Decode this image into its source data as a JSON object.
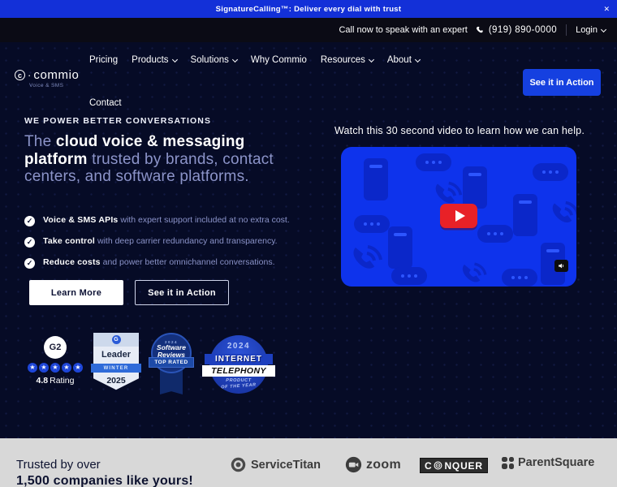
{
  "icons": {
    "close": "✕",
    "check": "✓",
    "star": "★"
  },
  "banner": {
    "text": "SignatureCalling™: Deliver every dial with trust"
  },
  "topbar": {
    "call_text": "Call now to speak with an expert",
    "phone": "(919) 890-0000",
    "login_label": "Login"
  },
  "nav": {
    "logo_icon": "c",
    "logo_dot": "·",
    "logo_text": "commio",
    "logo_sub": "Voice & SMS",
    "items": [
      {
        "label": "Pricing"
      },
      {
        "label": "Products"
      },
      {
        "label": "Solutions"
      },
      {
        "label": "Why Commio"
      },
      {
        "label": "Resources"
      },
      {
        "label": "About"
      },
      {
        "label": "Contact"
      }
    ],
    "cta_label": "See it in Action"
  },
  "hero": {
    "eyebrow": "WE POWER BETTER CONVERSATIONS",
    "heading_prefix": "The ",
    "heading_bold": "cloud voice & messaging platform",
    "heading_rest": " trusted by brands, contact centers, and software platforms.",
    "bullets": [
      {
        "bold": "Voice & SMS APIs",
        "rest": " with expert support included at no extra cost."
      },
      {
        "bold": "Take control",
        "rest": " with deep carrier redundancy and transparency."
      },
      {
        "bold": "Reduce costs",
        "rest": " and power better omnichannel conversations."
      }
    ],
    "learn_more_label": "Learn More",
    "see_action_label": "See it in Action"
  },
  "video": {
    "caption": "Watch this 30 second video to learn how we can help."
  },
  "badges": {
    "g2": {
      "logo_text": "G2",
      "rating": "4.8",
      "rating_suffix": "Rating"
    },
    "leader": {
      "logo_text": "G",
      "title": "Leader",
      "season": "WINTER",
      "year": "2025"
    },
    "top_rated": {
      "year": "2024",
      "brand_line1": "Software",
      "brand_line2": "Reviews",
      "title": "TOP RATED"
    },
    "telephony": {
      "year": "2024",
      "line1": "INTERNET",
      "line2": "TELEPHONY",
      "line3": "PRODUCT",
      "line4": "OF THE YEAR"
    }
  },
  "trustbar": {
    "line1": "Trusted by over",
    "line2": "1,500 companies like yours!",
    "logos": [
      {
        "name": "ServiceTitan"
      },
      {
        "name": "zoom"
      },
      {
        "name": "CONQUER",
        "prefix": "C",
        "suffix": "NQUER"
      },
      {
        "name": "ParentSquare"
      }
    ]
  },
  "colors": {
    "accent_blue": "#1540e0",
    "banner_blue": "#1330d8",
    "video_blue": "#0e33ec",
    "play_red": "#e82127",
    "hero_bg": "#060b26",
    "topbar_bg": "#0b0b15",
    "trust_gray": "#d8d8d8"
  }
}
